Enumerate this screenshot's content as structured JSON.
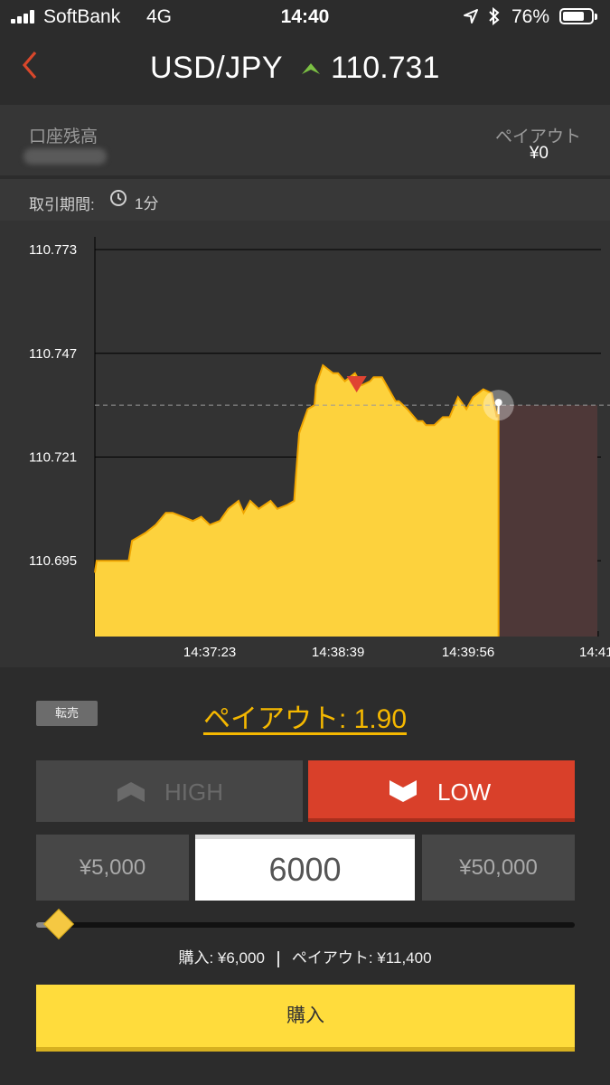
{
  "status_bar": {
    "carrier": "SoftBank",
    "network": "4G",
    "time": "14:40",
    "battery_percent": "76%",
    "battery_level": 0.76
  },
  "header": {
    "back_icon": "chevron-left-icon",
    "pair": "USD/JPY",
    "direction_icon": "up-arrow-icon",
    "price": "110.731",
    "accent_color": "#d9472b",
    "up_color": "#7bc043"
  },
  "account": {
    "balance_label": "口座残高",
    "payout_label": "ペイアウト",
    "payout_value": "¥0"
  },
  "period": {
    "label": "取引期間:",
    "value": "1分"
  },
  "chart_data": {
    "type": "area",
    "y_ticks": [
      "110.773",
      "110.747",
      "110.721",
      "110.695"
    ],
    "y_tick_values": [
      110.773,
      110.747,
      110.721,
      110.695
    ],
    "x_ticks": [
      "14:37:23",
      "14:38:39",
      "14:39:56",
      "14:41:"
    ],
    "x_tick_seconds": [
      0,
      76,
      153,
      230
    ],
    "x_range_seconds": [
      -68,
      237
    ],
    "ylim": [
      110.676,
      110.778
    ],
    "current_value": 110.734,
    "current_time_seconds": 171,
    "series": [
      {
        "x": [
          -68,
          -67,
          -48,
          -46,
          -42,
          -38,
          -32,
          -26,
          -22,
          -16,
          -10,
          -5,
          0,
          6,
          11,
          17,
          20,
          24,
          29,
          36,
          40,
          46,
          50,
          51,
          53,
          58,
          62,
          63,
          67,
          73,
          76,
          80,
          86,
          90,
          95,
          97,
          102,
          106,
          110,
          112,
          117,
          123,
          126,
          128,
          133,
          138,
          142,
          147,
          152,
          156,
          162,
          167,
          170,
          171
        ],
        "y": [
          110.692,
          110.695,
          110.695,
          110.7,
          110.701,
          110.702,
          110.704,
          110.707,
          110.707,
          110.706,
          110.705,
          110.706,
          110.704,
          110.705,
          110.708,
          110.71,
          110.707,
          110.71,
          110.708,
          110.71,
          110.708,
          110.709,
          110.71,
          110.716,
          110.727,
          110.733,
          110.734,
          110.739,
          110.744,
          110.742,
          110.742,
          110.74,
          110.742,
          110.739,
          110.74,
          110.741,
          110.741,
          110.738,
          110.735,
          110.735,
          110.733,
          110.73,
          110.73,
          110.729,
          110.729,
          110.731,
          110.731,
          110.736,
          110.733,
          110.736,
          110.738,
          110.737,
          110.731,
          110.734
        ]
      }
    ],
    "entry_marker": {
      "x": 87,
      "y": 110.739
    },
    "area_color": "#fdd23d",
    "line_color": "#f0a500",
    "marker_color": "#e04432",
    "grid": true
  },
  "trade": {
    "resell_label": "転売",
    "payout_rate_text": "ペイアウト: 1.90",
    "high_label": "HIGH",
    "low_label": "LOW",
    "high_icon": "up-chevron-icon",
    "low_icon": "down-chevron-icon",
    "low_color": "#d9402a",
    "preset_low": "¥5,000",
    "amount": "6000",
    "preset_high": "¥50,000",
    "slider_fraction": 0.04,
    "summary_buy": "購入: ¥6,000",
    "summary_payout": "ペイアウト: ¥11,400",
    "buy_label": "購入",
    "buy_color": "#ffdc3c"
  }
}
